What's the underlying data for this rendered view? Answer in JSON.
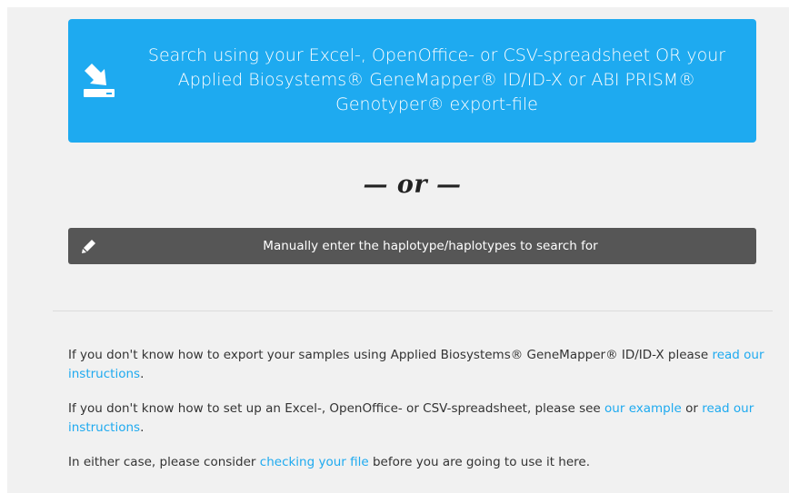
{
  "upload": {
    "label": "Search using your Excel-, OpenOffice- or CSV-spreadsheet OR your Applied Biosystems® GeneMapper® ID/ID-X or ABI PRISM® Genotyper® export-file",
    "icon": "upload-icon",
    "color": "#1eaaf0"
  },
  "or_divider": "— or —",
  "manual": {
    "label": "Manually enter the haplotype/haplotypes to search for",
    "icon": "pencil-icon",
    "color": "#565656"
  },
  "info": {
    "p1_text": "If you don't know how to export your samples using Applied Biosystems® GeneMapper® ID/ID-X please ",
    "p1_link": "read our instructions",
    "p1_end": ".",
    "p2_text": "If you don't know how to set up an Excel-, OpenOffice- or CSV-spreadsheet, please see ",
    "p2_link1": "our example",
    "p2_mid": " or ",
    "p2_link2": "read our instructions",
    "p2_end": ".",
    "p3_text": "In either case, please consider ",
    "p3_link": "checking your file",
    "p3_end": " before you are going to use it here.",
    "link_color": "#1eaaf0"
  }
}
